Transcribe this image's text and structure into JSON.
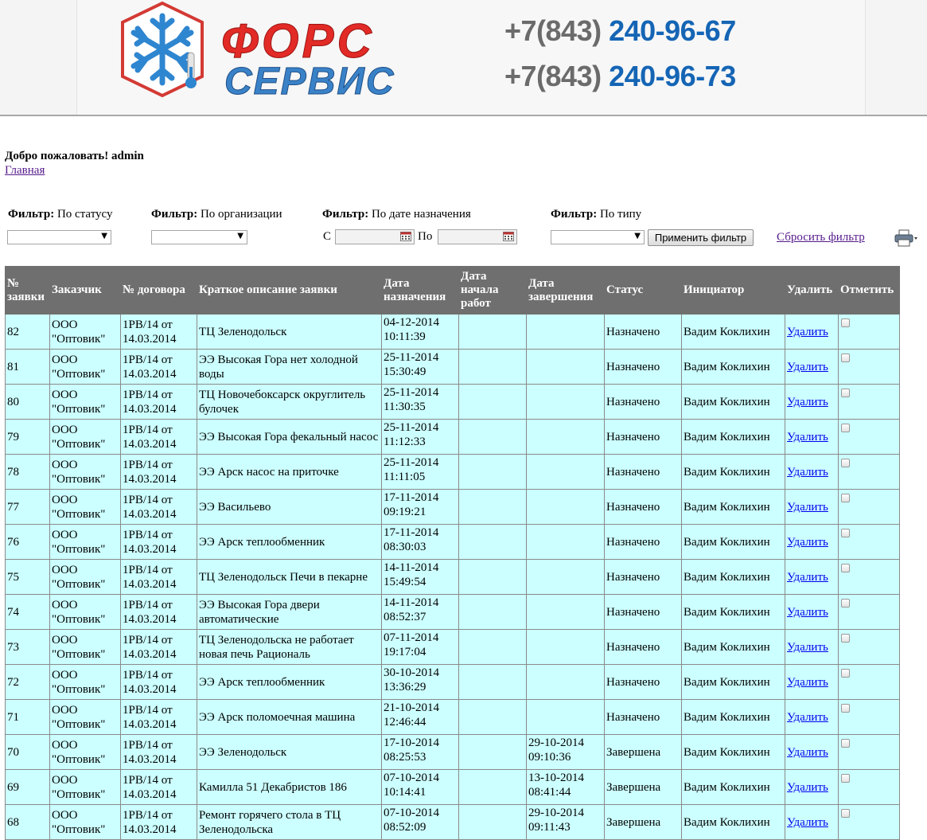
{
  "header": {
    "logo_text_1": "ФОРС",
    "logo_text_2": "СЕРВИС",
    "phones": [
      {
        "prefix": "+7(843) ",
        "number": "240-96-67"
      },
      {
        "prefix": "+7(843) ",
        "number": "240-96-73"
      }
    ],
    "colors": {
      "logo_red": "#e22a26",
      "logo_blue": "#3a82c8",
      "phone_blue": "#1565b5",
      "phone_gray": "#6b6b6b"
    }
  },
  "welcome": "Добро пожаловать! admin",
  "home_link": "Главная",
  "filters": {
    "status": {
      "label_bold": "Фильтр:",
      "label": " По статусу",
      "value": ""
    },
    "organization": {
      "label_bold": "Фильтр:",
      "label": " По организации",
      "value": ""
    },
    "date": {
      "label_bold": "Фильтр:",
      "label": " По дате назначения",
      "from_label": "С",
      "to_label": "По",
      "from_value": "",
      "to_value": ""
    },
    "type": {
      "label_bold": "Фильтр:",
      "label": " По типу",
      "value": ""
    },
    "apply_button": "Применить фильтр",
    "reset_link": "Сбросить фильтр"
  },
  "table": {
    "columns": [
      "№ заявки",
      "Заказчик",
      "№ договора",
      "Краткое описание заявки",
      "Дата назначения",
      "Дата начала работ",
      "Дата завершения",
      "Статус",
      "Инициатор",
      "Удалить",
      "Отметить"
    ],
    "colors": {
      "header_bg": "#6f6f6f",
      "row_bg": "#ccffff",
      "link": "#0000ee"
    },
    "rows": [
      {
        "id": "82",
        "customer": "ООО \"Оптовик\"",
        "contract": "1РВ/14 от 14.03.2014",
        "desc": "ТЦ Зеленодольск",
        "assigned_date": "04-12-2014",
        "assigned_time": "10:11:39",
        "start_date": "",
        "start_time": "",
        "end_date": "",
        "end_time": "",
        "status": "Назначено",
        "initiator": "Вадим Коклихин",
        "delete": "Удалить"
      },
      {
        "id": "81",
        "customer": "ООО \"Оптовик\"",
        "contract": "1РВ/14 от 14.03.2014",
        "desc": "ЭЭ Высокая Гора нет холодной воды",
        "assigned_date": "25-11-2014",
        "assigned_time": "15:30:49",
        "start_date": "",
        "start_time": "",
        "end_date": "",
        "end_time": "",
        "status": "Назначено",
        "initiator": "Вадим Коклихин",
        "delete": "Удалить"
      },
      {
        "id": "80",
        "customer": "ООО \"Оптовик\"",
        "contract": "1РВ/14 от 14.03.2014",
        "desc": "ТЦ Новочебоксарск округлитель булочек",
        "assigned_date": "25-11-2014",
        "assigned_time": "11:30:35",
        "start_date": "",
        "start_time": "",
        "end_date": "",
        "end_time": "",
        "status": "Назначено",
        "initiator": "Вадим Коклихин",
        "delete": "Удалить"
      },
      {
        "id": "79",
        "customer": "ООО \"Оптовик\"",
        "contract": "1РВ/14 от 14.03.2014",
        "desc": "ЭЭ Высокая Гора фекальный насос",
        "assigned_date": "25-11-2014",
        "assigned_time": "11:12:33",
        "start_date": "",
        "start_time": "",
        "end_date": "",
        "end_time": "",
        "status": "Назначено",
        "initiator": "Вадим Коклихин",
        "delete": "Удалить"
      },
      {
        "id": "78",
        "customer": "ООО \"Оптовик\"",
        "contract": "1РВ/14 от 14.03.2014",
        "desc": "ЭЭ Арск насос на приточке",
        "assigned_date": "25-11-2014",
        "assigned_time": "11:11:05",
        "start_date": "",
        "start_time": "",
        "end_date": "",
        "end_time": "",
        "status": "Назначено",
        "initiator": "Вадим Коклихин",
        "delete": "Удалить"
      },
      {
        "id": "77",
        "customer": "ООО \"Оптовик\"",
        "contract": "1РВ/14 от 14.03.2014",
        "desc": "ЭЭ Васильево",
        "assigned_date": "17-11-2014",
        "assigned_time": "09:19:21",
        "start_date": "",
        "start_time": "",
        "end_date": "",
        "end_time": "",
        "status": "Назначено",
        "initiator": "Вадим Коклихин",
        "delete": "Удалить"
      },
      {
        "id": "76",
        "customer": "ООО \"Оптовик\"",
        "contract": "1РВ/14 от 14.03.2014",
        "desc": "ЭЭ Арск теплообменник",
        "assigned_date": "17-11-2014",
        "assigned_time": "08:30:03",
        "start_date": "",
        "start_time": "",
        "end_date": "",
        "end_time": "",
        "status": "Назначено",
        "initiator": "Вадим Коклихин",
        "delete": "Удалить"
      },
      {
        "id": "75",
        "customer": "ООО \"Оптовик\"",
        "contract": "1РВ/14 от 14.03.2014",
        "desc": "ТЦ Зеленодольск Печи в пекарне",
        "assigned_date": "14-11-2014",
        "assigned_time": "15:49:54",
        "start_date": "",
        "start_time": "",
        "end_date": "",
        "end_time": "",
        "status": "Назначено",
        "initiator": "Вадим Коклихин",
        "delete": "Удалить"
      },
      {
        "id": "74",
        "customer": "ООО \"Оптовик\"",
        "contract": "1РВ/14 от 14.03.2014",
        "desc": "ЭЭ Высокая Гора двери автоматические",
        "assigned_date": "14-11-2014",
        "assigned_time": "08:52:37",
        "start_date": "",
        "start_time": "",
        "end_date": "",
        "end_time": "",
        "status": "Назначено",
        "initiator": "Вадим Коклихин",
        "delete": "Удалить"
      },
      {
        "id": "73",
        "customer": "ООО \"Оптовик\"",
        "contract": "1РВ/14 от 14.03.2014",
        "desc": "ТЦ Зеленодольска не работает новая печь Рациональ",
        "assigned_date": "07-11-2014",
        "assigned_time": "19:17:04",
        "start_date": "",
        "start_time": "",
        "end_date": "",
        "end_time": "",
        "status": "Назначено",
        "initiator": "Вадим Коклихин",
        "delete": "Удалить"
      },
      {
        "id": "72",
        "customer": "ООО \"Оптовик\"",
        "contract": "1РВ/14 от 14.03.2014",
        "desc": "ЭЭ Арск теплообменник",
        "assigned_date": "30-10-2014",
        "assigned_time": "13:36:29",
        "start_date": "",
        "start_time": "",
        "end_date": "",
        "end_time": "",
        "status": "Назначено",
        "initiator": "Вадим Коклихин",
        "delete": "Удалить"
      },
      {
        "id": "71",
        "customer": "ООО \"Оптовик\"",
        "contract": "1РВ/14 от 14.03.2014",
        "desc": "ЭЭ Арск поломоечная машина",
        "assigned_date": "21-10-2014",
        "assigned_time": "12:46:44",
        "start_date": "",
        "start_time": "",
        "end_date": "",
        "end_time": "",
        "status": "Назначено",
        "initiator": "Вадим Коклихин",
        "delete": "Удалить"
      },
      {
        "id": "70",
        "customer": "ООО \"Оптовик\"",
        "contract": "1РВ/14 от 14.03.2014",
        "desc": "ЭЭ Зеленодольск",
        "assigned_date": "17-10-2014",
        "assigned_time": "08:25:53",
        "start_date": "",
        "start_time": "",
        "end_date": "29-10-2014",
        "end_time": "09:10:36",
        "status": "Завершена",
        "initiator": "Вадим Коклихин",
        "delete": "Удалить"
      },
      {
        "id": "69",
        "customer": "ООО \"Оптовик\"",
        "contract": "1РВ/14 от 14.03.2014",
        "desc": "Камилла 51 Декабристов 186",
        "assigned_date": "07-10-2014",
        "assigned_time": "10:14:41",
        "start_date": "",
        "start_time": "",
        "end_date": "13-10-2014",
        "end_time": "08:41:44",
        "status": "Завершена",
        "initiator": "Вадим Коклихин",
        "delete": "Удалить"
      },
      {
        "id": "68",
        "customer": "ООО \"Оптовик\"",
        "contract": "1РВ/14 от 14.03.2014",
        "desc": "Ремонт горячего стола в ТЦ Зеленодольска",
        "assigned_date": "07-10-2014",
        "assigned_time": "08:52:09",
        "start_date": "",
        "start_time": "",
        "end_date": "29-10-2014",
        "end_time": "09:11:43",
        "status": "Завершена",
        "initiator": "Вадим Коклихин",
        "delete": "Удалить"
      }
    ]
  }
}
